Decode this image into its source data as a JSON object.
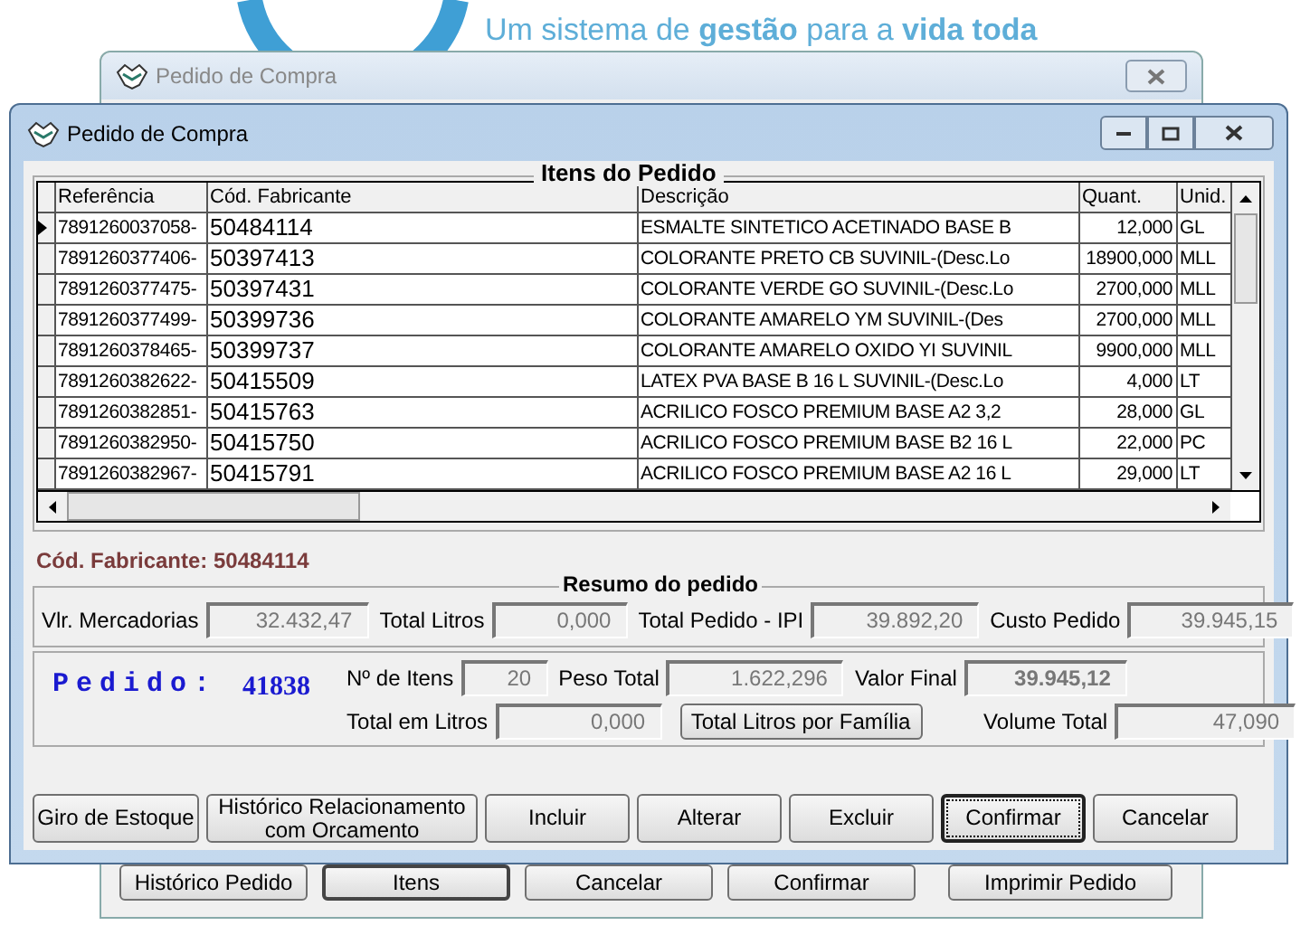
{
  "banner": {
    "tagline": "Um sistema de **gestão** para a **vida toda**"
  },
  "back_window": {
    "title": "Pedido de Compra",
    "buttons": [
      {
        "label": "Histórico Pedido",
        "selected": false
      },
      {
        "label": "Itens",
        "selected": true
      },
      {
        "label": "Cancelar",
        "selected": false
      },
      {
        "label": "Confirmar",
        "selected": false
      },
      {
        "label": "Imprimir Pedido",
        "selected": false
      }
    ]
  },
  "window": {
    "title": "Pedido de Compra"
  },
  "items": {
    "title": "Itens do Pedido",
    "columns": [
      "Referência",
      "Cód. Fabricante",
      "Descrição",
      "Quant.",
      "Unid."
    ],
    "rows": [
      {
        "selected": true,
        "cells": [
          "7891260037058-",
          "50484114",
          "ESMALTE SINTETICO ACETINADO BASE B",
          "12,000",
          "GL"
        ]
      },
      {
        "selected": false,
        "cells": [
          "7891260377406-",
          "50397413",
          "COLORANTE PRETO CB SUVINIL-(Desc.Lo",
          "18900,000",
          "MLL"
        ]
      },
      {
        "selected": false,
        "cells": [
          "7891260377475-",
          "50397431",
          "COLORANTE VERDE GO SUVINIL-(Desc.Lo",
          "2700,000",
          "MLL"
        ]
      },
      {
        "selected": false,
        "cells": [
          "7891260377499-",
          "50399736",
          "COLORANTE AMARELO YM SUVINIL-(Des",
          "2700,000",
          "MLL"
        ]
      },
      {
        "selected": false,
        "cells": [
          "7891260378465-",
          "50399737",
          "COLORANTE AMARELO OXIDO YI SUVINIL",
          "9900,000",
          "MLL"
        ]
      },
      {
        "selected": false,
        "cells": [
          "7891260382622-",
          "50415509",
          "LATEX PVA BASE B 16 L SUVINIL-(Desc.Lo",
          "4,000",
          "LT"
        ]
      },
      {
        "selected": false,
        "cells": [
          "7891260382851-",
          "50415763",
          "ACRILICO FOSCO PREMIUM BASE A2 3,2",
          "28,000",
          "GL"
        ]
      },
      {
        "selected": false,
        "cells": [
          "7891260382950-",
          "50415750",
          "ACRILICO FOSCO PREMIUM BASE B2 16 L",
          "22,000",
          "PC"
        ]
      },
      {
        "selected": false,
        "cells": [
          "7891260382967-",
          "50415791",
          "ACRILICO FOSCO PREMIUM BASE A2 16 L",
          "29,000",
          "LT"
        ]
      }
    ]
  },
  "manufacturer_code": "Cód. Fabricante: 50484114",
  "summary": {
    "title": "Resumo do pedido",
    "fields": [
      {
        "label": "Vlr. Mercadorias",
        "value": "32.432,47"
      },
      {
        "label": "Total Litros",
        "value": "0,000"
      },
      {
        "label": "Total Pedido - IPI",
        "value": "39.892,20"
      },
      {
        "label": "Custo Pedido",
        "value": "39.945,15"
      }
    ]
  },
  "order": {
    "label": "Pedido:",
    "number": "41838",
    "fields_top": [
      {
        "label": "Nº de Itens",
        "value": "20",
        "bold": false
      },
      {
        "label": "Peso Total",
        "value": "1.622,296",
        "bold": false
      },
      {
        "label": "Valor Final",
        "value": "39.945,12",
        "bold": true
      }
    ],
    "liters": {
      "label": "Total em Litros",
      "value": "0,000"
    },
    "family_button": "Total Litros por Família",
    "volume": {
      "label": "Volume Total",
      "value": "47,090"
    }
  },
  "buttons": [
    {
      "label": "Giro de Estoque",
      "focused": false
    },
    {
      "label": "Histórico Relacionamento com Orcamento",
      "focused": false
    },
    {
      "label": "Incluir",
      "focused": false
    },
    {
      "label": "Alterar",
      "focused": false
    },
    {
      "label": "Excluir",
      "focused": false
    },
    {
      "label": "Confirmar",
      "focused": true
    },
    {
      "label": "Cancelar",
      "focused": false
    }
  ]
}
